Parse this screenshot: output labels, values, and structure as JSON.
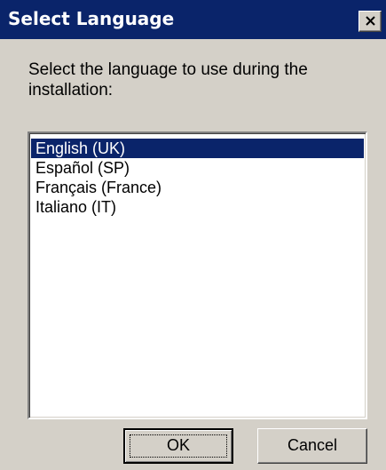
{
  "window": {
    "title": "Select Language"
  },
  "prompt": "Select the language to use during the installation:",
  "languages": {
    "selected_index": 0,
    "items": [
      {
        "label": "English (UK)"
      },
      {
        "label": "Español (SP)"
      },
      {
        "label": "Français (France)"
      },
      {
        "label": "Italiano (IT)"
      }
    ]
  },
  "buttons": {
    "ok_label": "OK",
    "cancel_label": "Cancel"
  },
  "icons": {
    "close": "close-icon"
  },
  "colors": {
    "title_bar": "#0a246a",
    "dialog_bg": "#d4d0c8",
    "selection": "#0a246a"
  }
}
